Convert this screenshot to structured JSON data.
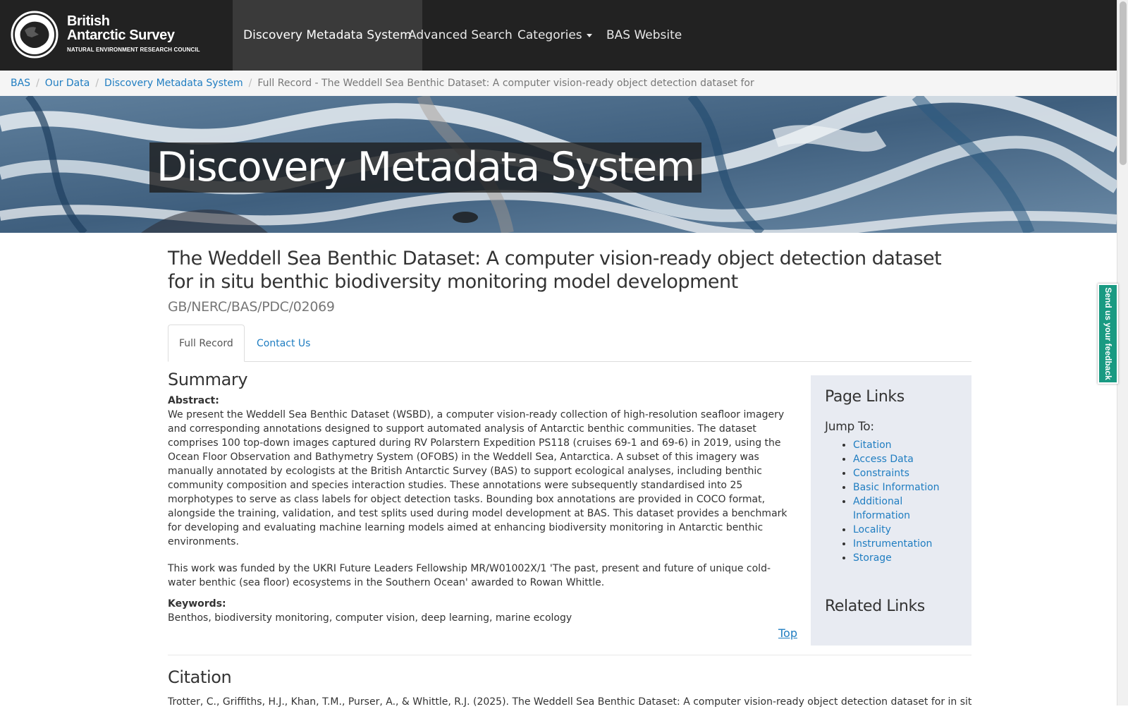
{
  "navbar": {
    "brand": {
      "line1": "British",
      "line2": "Antarctic Survey",
      "line3": "NATURAL ENVIRONMENT RESEARCH COUNCIL"
    },
    "items": [
      {
        "label": "Discovery Metadata System",
        "active": true
      },
      {
        "label": "Advanced Search"
      },
      {
        "label": "Categories",
        "dropdown": true
      },
      {
        "label": "BAS Website"
      }
    ]
  },
  "breadcrumb": {
    "items": [
      "BAS",
      "Our Data",
      "Discovery Metadata System"
    ],
    "current": "Full Record - The Weddell Sea Benthic Dataset: A computer vision-ready object detection dataset for"
  },
  "hero": {
    "title": "Discovery Metadata System"
  },
  "record": {
    "title": "The Weddell Sea Benthic Dataset: A computer vision-ready object detection dataset for in situ benthic biodiversity monitoring model development",
    "id": "GB/NERC/BAS/PDC/02069"
  },
  "tabs": [
    {
      "label": "Full Record",
      "active": true
    },
    {
      "label": "Contact Us"
    }
  ],
  "summary": {
    "heading": "Summary",
    "abstract_label": "Abstract:",
    "abstract_p1": "We present the Weddell Sea Benthic Dataset (WSBD), a computer vision-ready collection of high-resolution seafloor imagery and corresponding annotations designed to support automated analysis of Antarctic benthic communities. The dataset comprises 100 top-down images captured during RV Polarstern Expedition PS118 (cruises 69-1 and 69-6) in 2019, using the Ocean Floor Observation and Bathymetry System (OFOBS) in the Weddell Sea, Antarctica. A subset of this imagery was manually annotated by ecologists at the British Antarctic Survey (BAS) to support ecological analyses, including benthic community composition and species interaction studies. These annotations were subsequently standardised into 25 morphotypes to serve as class labels for object detection tasks. Bounding box annotations are provided in COCO format, alongside the training, validation, and test splits used during model development at BAS. This dataset provides a benchmark for developing and evaluating machine learning models aimed at enhancing biodiversity monitoring in Antarctic benthic environments.",
    "abstract_p2": "This work was funded by the UKRI Future Leaders Fellowship MR/W01002X/1 'The past, present and future of unique cold-water benthic (sea floor) ecosystems in the Southern Ocean' awarded to Rowan Whittle.",
    "keywords_label": "Keywords:",
    "keywords": "Benthos, biodiversity monitoring, computer vision, deep learning, marine ecology",
    "top_link": "Top"
  },
  "sidebar": {
    "heading": "Page Links",
    "jump_to": "Jump To:",
    "links": [
      "Citation",
      "Access Data",
      "Constraints",
      "Basic Information",
      "Additional Information",
      "Locality",
      "Instrumentation",
      "Storage"
    ],
    "related_heading": "Related Links"
  },
  "citation": {
    "heading": "Citation",
    "text": "Trotter, C., Griffiths, H.J., Khan, T.M., Purser, A., & Whittle, R.J. (2025). The Weddell Sea Benthic Dataset: A computer vision-ready object detection dataset for in situ benthic"
  },
  "feedback": {
    "label": "Send us your feedback"
  },
  "colors": {
    "navbar_bg": "#222222",
    "link": "#1f7dc1",
    "sidebar_bg": "#e8ebf2",
    "feedback_bg": "#199a82"
  },
  "icons": {
    "brand_emblem": "antarctica-emblem-icon",
    "dropdown": "caret-down-icon"
  }
}
